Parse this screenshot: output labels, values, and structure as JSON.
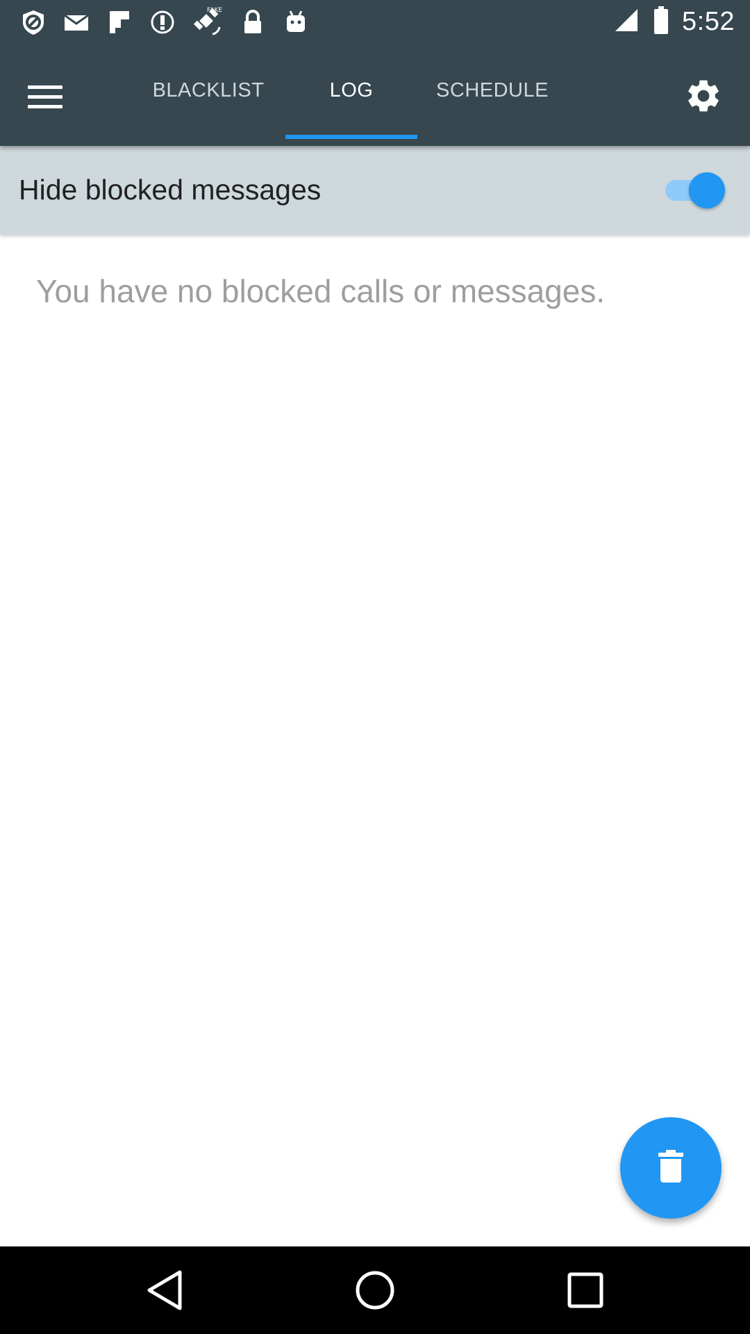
{
  "status_bar": {
    "time": "5:52",
    "icons": [
      "no-entry-icon",
      "mail-icon",
      "flipboard-icon",
      "info-circle-icon",
      "fake-gps-icon",
      "lock-icon",
      "android-icon",
      "signal-icon",
      "battery-icon"
    ]
  },
  "app_bar": {
    "menu_icon": "hamburger-menu-icon",
    "tabs": [
      {
        "label": "BLACKLIST",
        "active": false
      },
      {
        "label": "LOG",
        "active": true
      },
      {
        "label": "SCHEDULE",
        "active": false
      }
    ],
    "settings_icon": "gear-icon"
  },
  "toggle_row": {
    "label": "Hide blocked messages",
    "checked": true
  },
  "empty_state": {
    "message": "You have no blocked calls or messages."
  },
  "fab": {
    "icon": "trash-icon"
  },
  "nav_bar": {
    "icons": [
      "back-icon",
      "home-icon",
      "recents-icon"
    ]
  },
  "colors": {
    "app_bar": "#37474f",
    "accent": "#2196f3",
    "toggle_row_bg": "#cfd8dc",
    "empty_text": "#9e9e9e"
  }
}
